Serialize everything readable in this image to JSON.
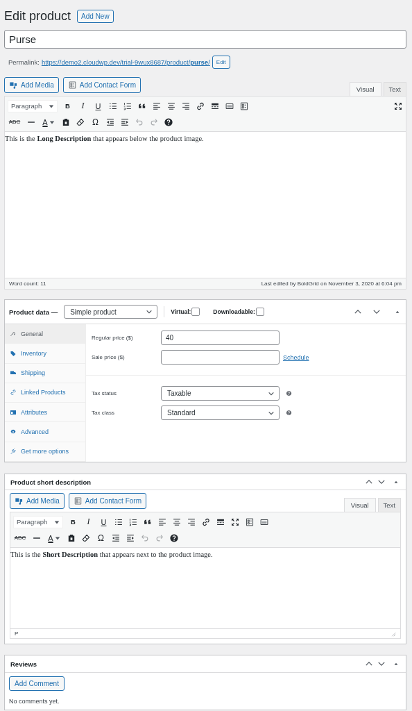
{
  "page_title": "Edit product",
  "add_new": "Add New",
  "title_field": {
    "value": "Purse"
  },
  "permalink": {
    "label": "Permalink:",
    "url": "https://demo2.cloudwp.dev/trial-9wux8687/product/**purse**/",
    "edit": "Edit"
  },
  "editor": {
    "media_buttons": [
      {
        "kind": "media",
        "label": "Add Media"
      },
      {
        "kind": "form",
        "label": "Add Contact Form"
      }
    ],
    "tabs": [
      {
        "label": "Visual",
        "selected": true
      },
      {
        "label": "Text",
        "selected": false
      }
    ],
    "format": "Paragraph",
    "glyphs": {
      "bold": "B",
      "italic": "I",
      "underline": "U",
      "strike": "ABC",
      "text_color": "A",
      "special": "Ω"
    },
    "content": "This is the **Long Description** that appears below the product image.",
    "word_count": "Word count: 11",
    "last_edited": "Last edited by BoldGrid on November 3, 2020 at 6:04 pm"
  },
  "product_data": {
    "title": "Product data —",
    "type_select": "Simple product",
    "checkboxes": [
      {
        "label": "Virtual:",
        "checked": false
      },
      {
        "label": "Downloadable:",
        "checked": false
      }
    ],
    "tabs": [
      {
        "kind": "wrench",
        "label": "General",
        "selected": true
      },
      {
        "kind": "tag",
        "label": "Inventory",
        "selected": false
      },
      {
        "kind": "truck",
        "label": "Shipping",
        "selected": false
      },
      {
        "kind": "link",
        "label": "Linked Products",
        "selected": false
      },
      {
        "kind": "table",
        "label": "Attributes",
        "selected": false
      },
      {
        "kind": "gear",
        "label": "Advanced",
        "selected": false
      },
      {
        "kind": "plug",
        "label": "Get more options",
        "selected": false
      }
    ],
    "pricing": [
      {
        "label": "Regular price ($)",
        "value": "40"
      },
      {
        "label": "Sale price ($)",
        "link": "Schedule"
      }
    ],
    "tax": [
      {
        "label": "Tax status",
        "value": "Taxable"
      },
      {
        "label": "Tax class",
        "value": "Standard"
      }
    ]
  },
  "short_description": {
    "title": "Product short description",
    "media_buttons": [
      {
        "kind": "media",
        "label": "Add Media"
      },
      {
        "kind": "form",
        "label": "Add Contact Form"
      }
    ],
    "tabs": [
      {
        "label": "Visual",
        "selected": true
      },
      {
        "label": "Text",
        "selected": false
      }
    ],
    "format": "Paragraph",
    "glyphs": {
      "bold": "B",
      "italic": "I",
      "underline": "U",
      "strike": "ABC",
      "text_color": "A",
      "special": "Ω"
    },
    "content": "This is the **Short Description** that appears next to the product image.",
    "path": "P"
  },
  "reviews": {
    "title": "Reviews",
    "button": "Add Comment",
    "empty": "No comments yet."
  }
}
